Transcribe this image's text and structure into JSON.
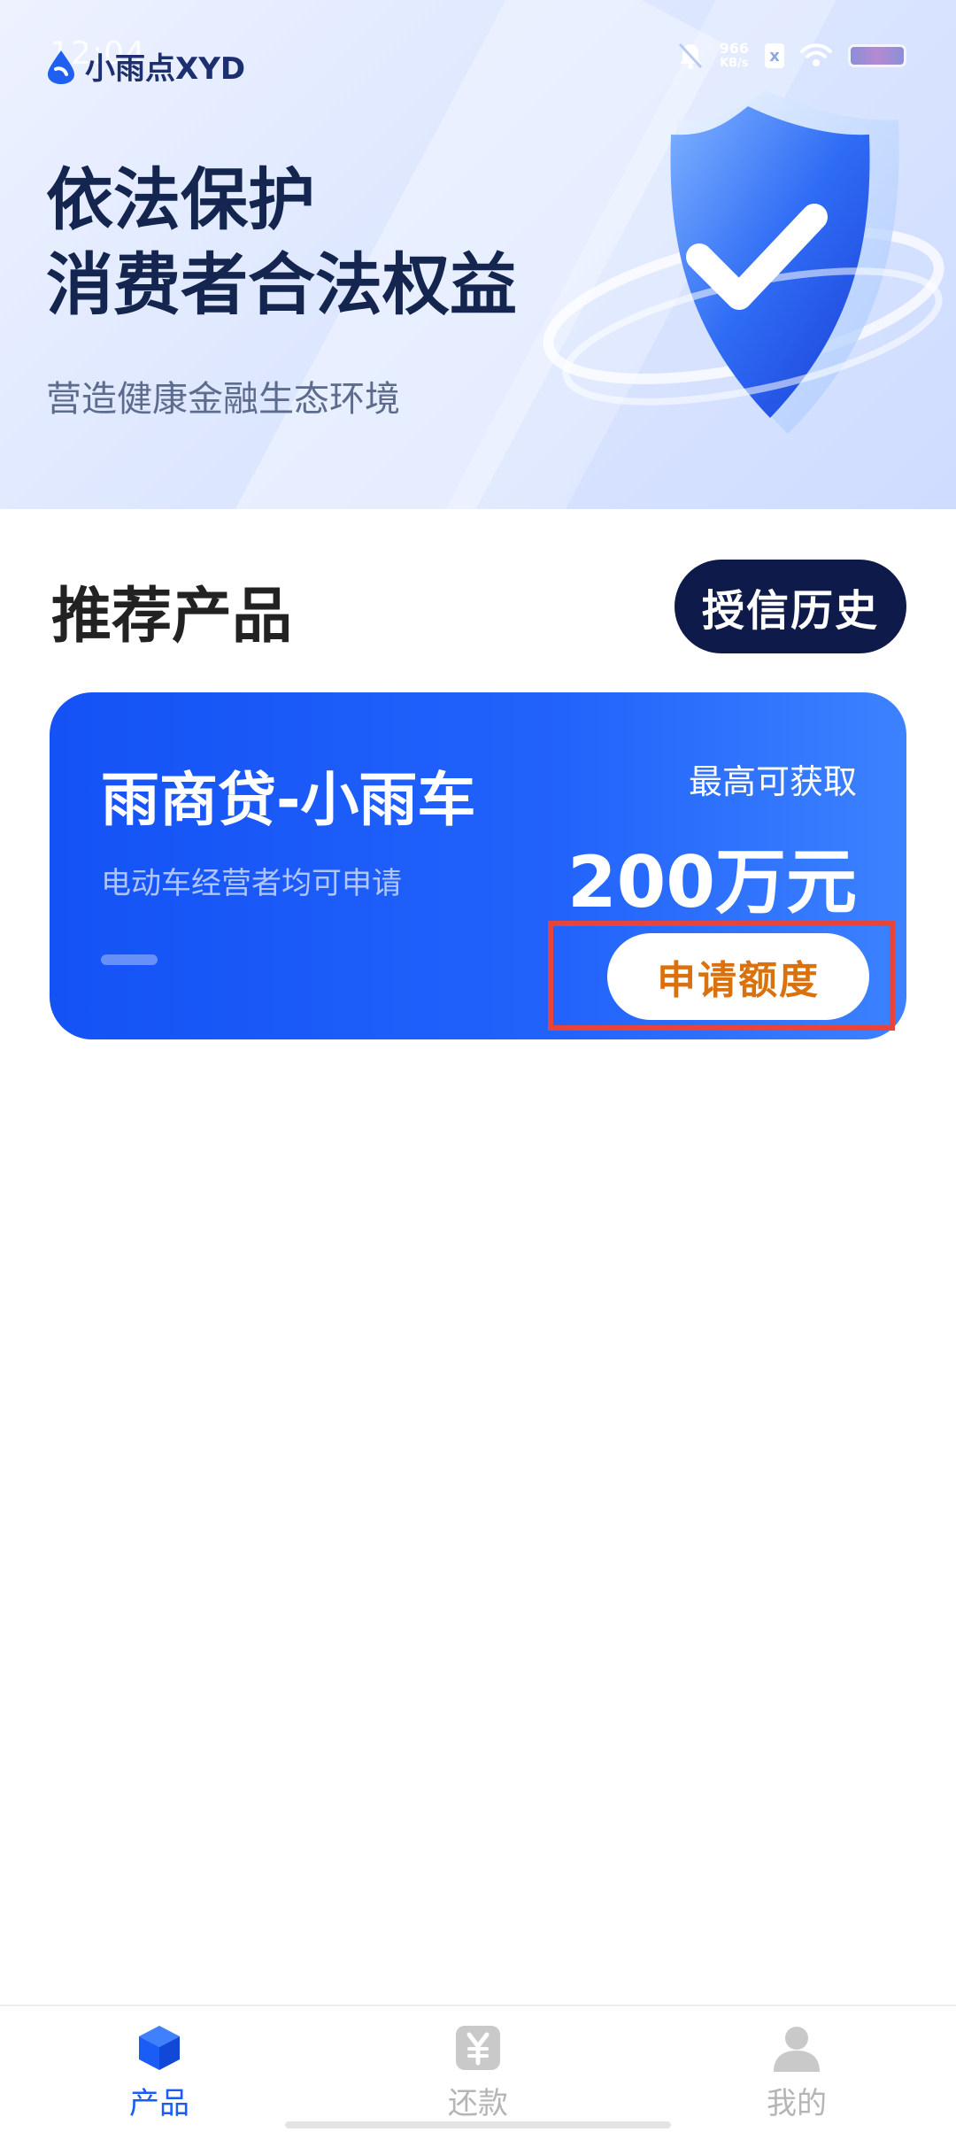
{
  "status_bar": {
    "time": "12:04",
    "net_speed_value": "966",
    "net_speed_unit": "KB/s",
    "sim_label": "x"
  },
  "brand": {
    "name": "小雨点XYD"
  },
  "banner": {
    "title_line1": "依法保护",
    "title_line2": "消费者合法权益",
    "subtitle": "营造健康金融生态环境"
  },
  "section": {
    "title": "推荐产品",
    "history_button": "授信历史"
  },
  "product": {
    "name": "雨商贷-小雨车",
    "description": "电动车经营者均可申请",
    "max_label": "最高可获取",
    "amount": "200万元",
    "apply_button": "申请额度"
  },
  "bottom_nav": {
    "items": [
      {
        "label": "产品",
        "icon": "cube-icon",
        "active": true
      },
      {
        "label": "还款",
        "icon": "yuan-icon",
        "active": false
      },
      {
        "label": "我的",
        "icon": "person-icon",
        "active": false
      }
    ]
  },
  "colors": {
    "accent": "#1a5cf6",
    "card_gradient_start": "#1452f5",
    "card_gradient_end": "#3c82ff",
    "history_button_bg": "#0e1a4a",
    "apply_button_text": "#d9720e",
    "highlight": "#e8443c"
  }
}
